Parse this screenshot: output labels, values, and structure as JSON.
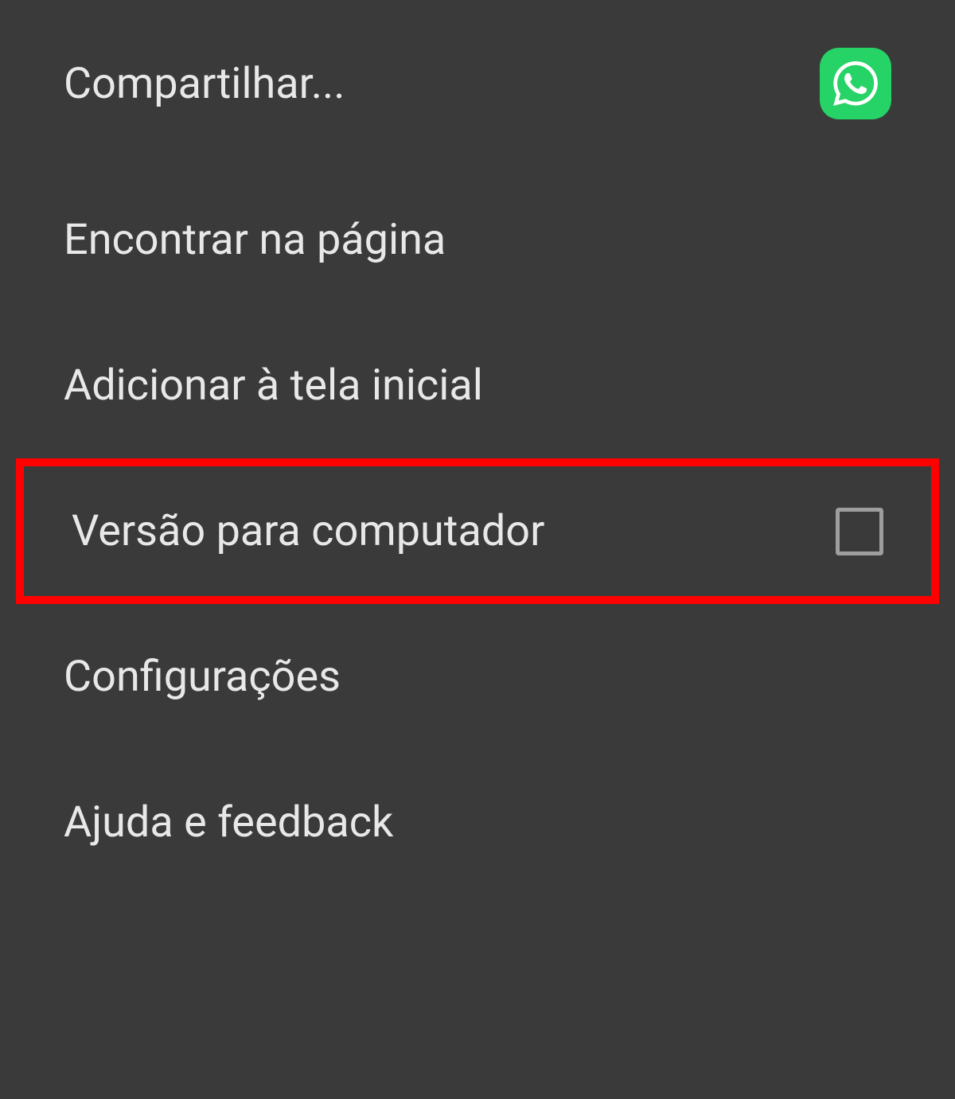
{
  "menu": {
    "items": [
      {
        "label": "Compartilhar...",
        "icon": "whatsapp"
      },
      {
        "label": "Encontrar na página"
      },
      {
        "label": "Adicionar à tela inicial"
      },
      {
        "label": "Versão para computador",
        "checkbox": true,
        "highlighted": true
      },
      {
        "label": "Configurações"
      },
      {
        "label": "Ajuda e feedback"
      }
    ]
  }
}
